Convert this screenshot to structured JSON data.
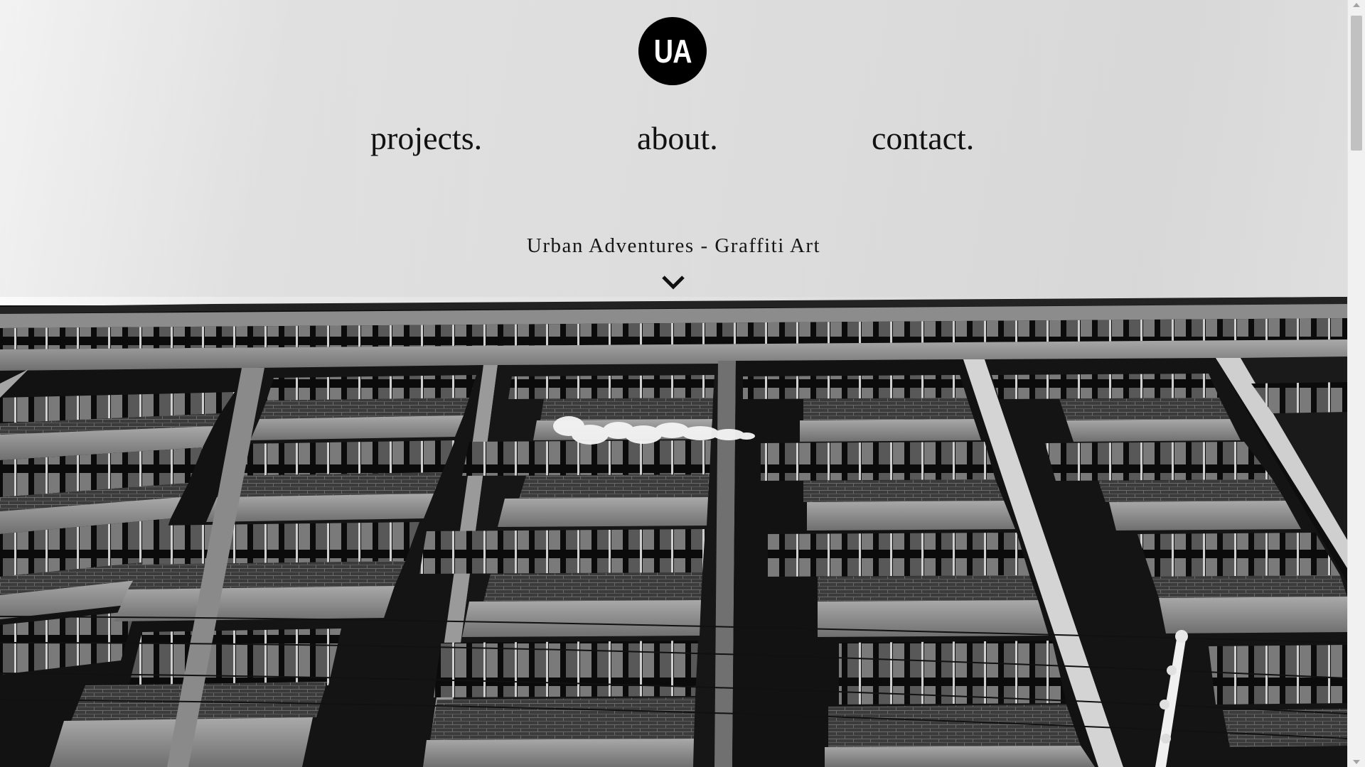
{
  "brand": {
    "logo_text": "UA",
    "icon": "ua-circle-logo"
  },
  "nav": {
    "projects": "projects.",
    "about": "about.",
    "contact": "contact."
  },
  "hero": {
    "subtitle": "Urban Adventures - Graffiti Art",
    "scroll_icon": "chevron-down-icon",
    "image": "black-and-white photo of a brutalist office building facade shot from below"
  },
  "scrollbar": {
    "position_fraction": 0
  },
  "colors": {
    "text": "#111111",
    "logo_bg": "#000000",
    "logo_fg": "#ffffff",
    "sky": "#e2e2e2"
  }
}
